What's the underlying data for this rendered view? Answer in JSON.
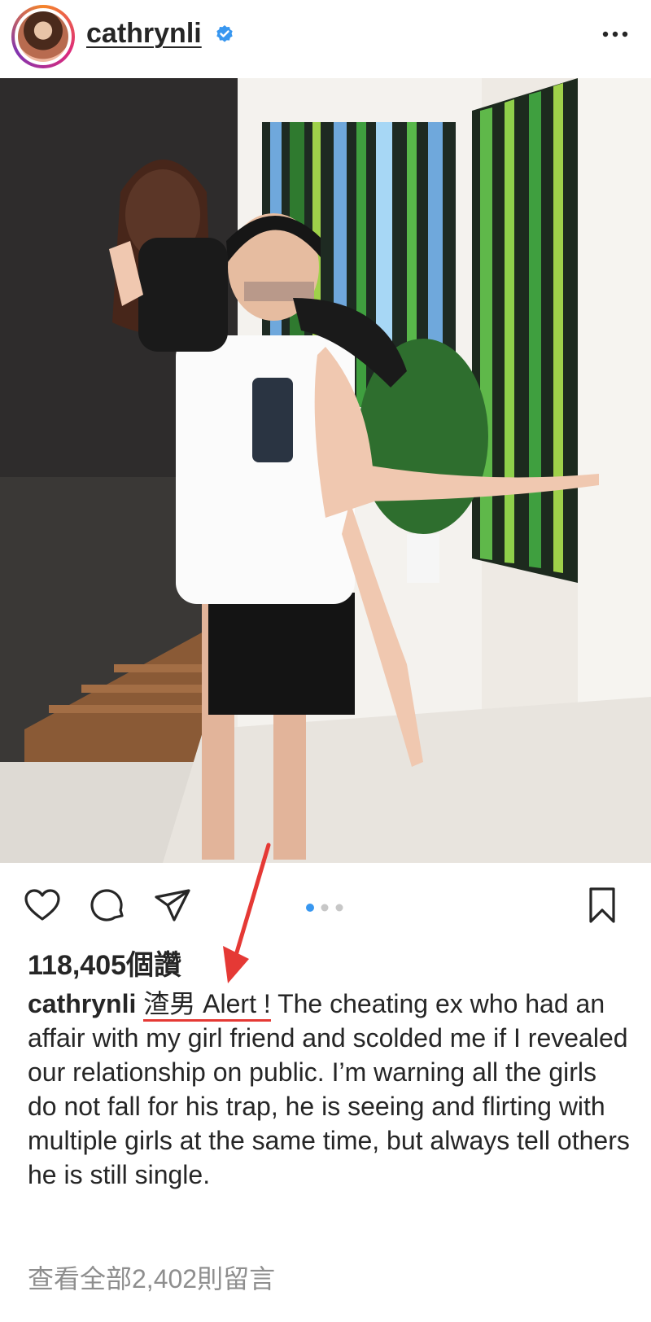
{
  "post": {
    "username": "cathrynli",
    "verified": true,
    "more_icon": "more-horizontal-icon"
  },
  "photo": {
    "carousel_count": 3,
    "carousel_active": 1
  },
  "actions": {
    "like_icon": "heart-icon",
    "comment_icon": "comment-icon",
    "share_icon": "send-icon",
    "save_icon": "bookmark-icon"
  },
  "likes": {
    "text": "118,405個讚"
  },
  "caption": {
    "username": "cathrynli",
    "highlight": "渣男 Alert !",
    "body": "The cheating ex who had an affair with my girl friend and scolded me if I revealed our relationship on public. I’m warning all the girls do not fall for his trap, he is seeing and flirting with multiple girls at the same time, but always tell others he is still single."
  },
  "comments": {
    "view_all": "查看全部2,402則留言"
  },
  "colors": {
    "text": "#262626",
    "muted": "#8e8e8e",
    "verified_blue": "#3897f0",
    "carousel_active": "#3897f0",
    "annotation_red": "#e53935"
  }
}
